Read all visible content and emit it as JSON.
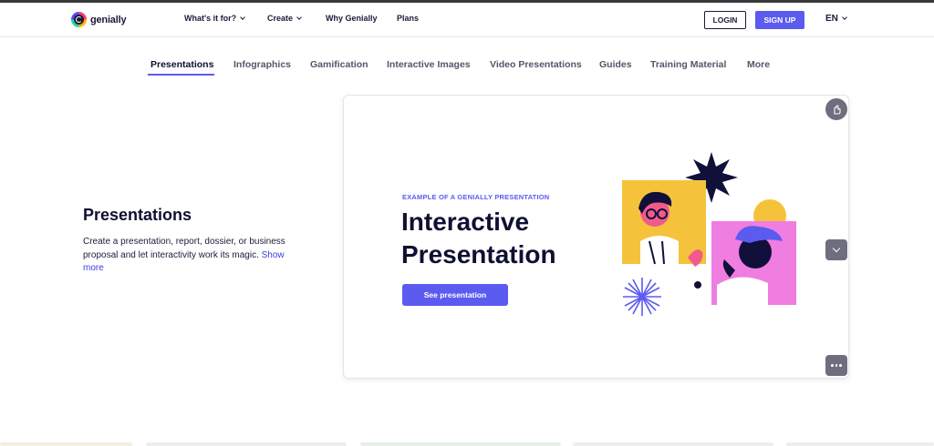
{
  "brand": {
    "name": "genially"
  },
  "nav": {
    "items": [
      {
        "label": "What's it for?",
        "has_dropdown": true
      },
      {
        "label": "Create",
        "has_dropdown": true
      },
      {
        "label": "Why Genially",
        "has_dropdown": false
      },
      {
        "label": "Plans",
        "has_dropdown": false
      }
    ],
    "login_label": "LOGIN",
    "signup_label": "SIGN UP",
    "language": "EN"
  },
  "tabs": [
    {
      "label": "Presentations",
      "active": true
    },
    {
      "label": "Infographics"
    },
    {
      "label": "Gamification"
    },
    {
      "label": "Interactive Images"
    },
    {
      "label": "Video Presentations"
    },
    {
      "label": "Guides"
    },
    {
      "label": "Training Material"
    },
    {
      "label": "More"
    }
  ],
  "section": {
    "title": "Presentations",
    "description": "Create a presentation, report, dossier, or business proposal and let interactivity work its magic.",
    "show_more": "Show more"
  },
  "preview": {
    "eyebrow": "EXAMPLE OF A GENIALLY PRESENTATION",
    "title_line1": "Interactive",
    "title_line2": "Presentation",
    "button_label": "See presentation",
    "controls": [
      "interact-hand-icon",
      "chevron-down-icon",
      "more-dots-icon"
    ]
  },
  "colors": {
    "accent": "#5b5bf0",
    "dark": "#0f0f32",
    "yellow": "#f5c33b",
    "pink": "#f07de0",
    "coral": "#f25a8c",
    "blue_violet": "#5b5bf0"
  }
}
